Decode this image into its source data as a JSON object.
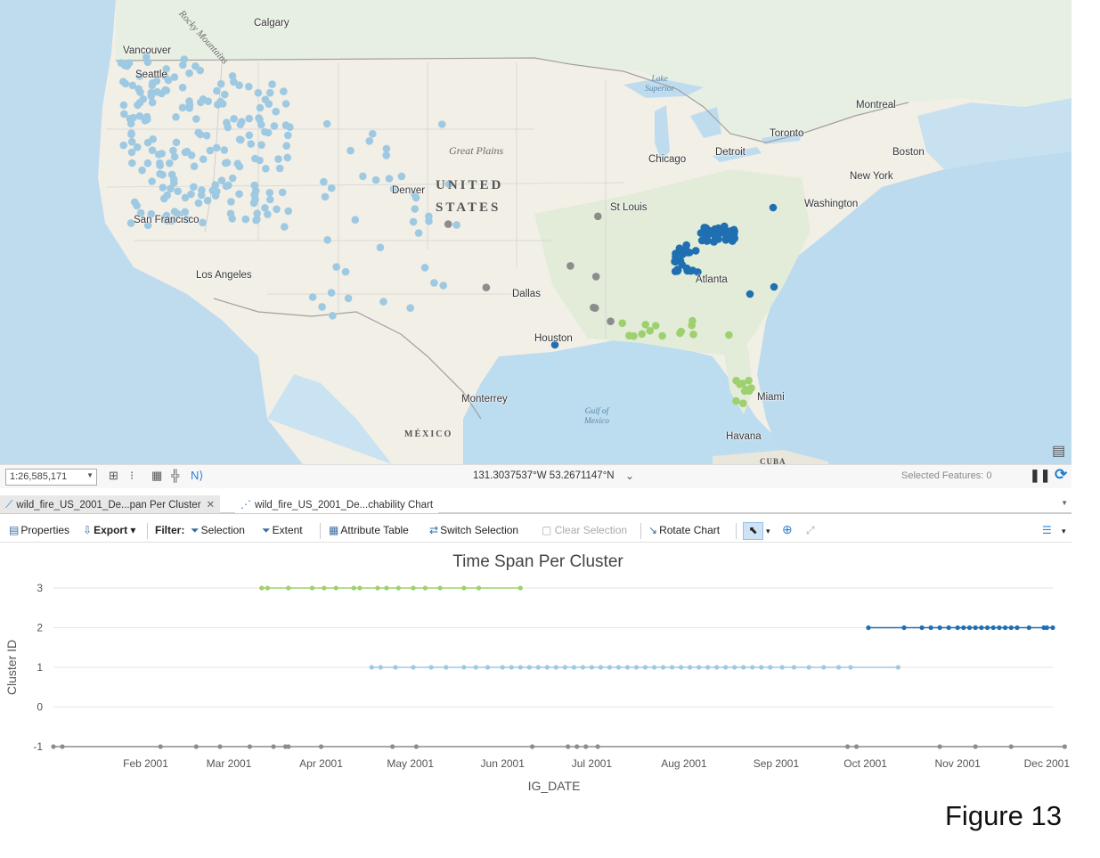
{
  "map": {
    "cities": [
      {
        "name": "Calgary"
      },
      {
        "name": "Vancouver"
      },
      {
        "name": "Seattle"
      },
      {
        "name": "San Francisco"
      },
      {
        "name": "Los Angeles"
      },
      {
        "name": "Denver"
      },
      {
        "name": "Dallas"
      },
      {
        "name": "Houston"
      },
      {
        "name": "Monterrey"
      },
      {
        "name": "St Louis"
      },
      {
        "name": "Chicago"
      },
      {
        "name": "Detroit"
      },
      {
        "name": "Toronto"
      },
      {
        "name": "Montreal"
      },
      {
        "name": "Boston"
      },
      {
        "name": "New York"
      },
      {
        "name": "Washington"
      },
      {
        "name": "Atlanta"
      },
      {
        "name": "Miami"
      },
      {
        "name": "Havana"
      }
    ],
    "region_labels": {
      "rocky": "Rocky Mountains",
      "great_plains": "Great Plains",
      "country_line1": "UNITED",
      "country_line2": "STATES",
      "mexico": "MÉXICO",
      "cuba": "CUBA"
    },
    "water_labels": {
      "lake_superior_1": "Lake",
      "lake_superior_2": "Superior",
      "gulf_1": "Gulf of",
      "gulf_2": "Mexico"
    },
    "cluster_colors": {
      "cluster_neg1": "#8c8c8c",
      "cluster_1": "#9ec9e2",
      "cluster_2": "#1f6fb2",
      "cluster_3": "#9ed06e"
    }
  },
  "statusbar": {
    "scale": "1:26,585,171",
    "coordinates": "131.3037537°W 53.2671147°N",
    "selected_features": "Selected Features: 0"
  },
  "tabs": [
    {
      "label": "wild_fire_US_2001_De...pan Per Cluster"
    },
    {
      "label": "wild_fire_US_2001_De...chability Chart"
    }
  ],
  "toolbar": {
    "properties": "Properties",
    "export": "Export",
    "filter": "Filter:",
    "selection": "Selection",
    "extent": "Extent",
    "attribute_table": "Attribute Table",
    "switch_selection": "Switch Selection",
    "clear_selection": "Clear Selection",
    "rotate_chart": "Rotate Chart"
  },
  "chart_data": {
    "type": "line",
    "title": "Time Span Per Cluster",
    "xlabel": "IG_DATE",
    "ylabel": "Cluster ID",
    "ylim": [
      -1,
      3
    ],
    "xlim": [
      "2001-01-01",
      "2001-12-03"
    ],
    "y_ticks": [
      "-1",
      "0",
      "1",
      "2",
      "3"
    ],
    "x_ticks": [
      {
        "date": "2001-02-01",
        "label": "Feb 2001"
      },
      {
        "date": "2001-03-01",
        "label": "Mar 2001"
      },
      {
        "date": "2001-04-01",
        "label": "Apr 2001"
      },
      {
        "date": "2001-05-01",
        "label": "May 2001"
      },
      {
        "date": "2001-06-01",
        "label": "Jun 2001"
      },
      {
        "date": "2001-07-01",
        "label": "Jul 2001"
      },
      {
        "date": "2001-08-01",
        "label": "Aug 2001"
      },
      {
        "date": "2001-09-01",
        "label": "Sep 2001"
      },
      {
        "date": "2001-10-01",
        "label": "Oct 2001"
      },
      {
        "date": "2001-11-01",
        "label": "Nov 2001"
      },
      {
        "date": "2001-12-01",
        "label": "Dec 2001"
      }
    ],
    "series": [
      {
        "y": 3,
        "color": "#9ed06e",
        "dates": [
          "2001-03-12",
          "2001-03-14",
          "2001-03-21",
          "2001-03-29",
          "2001-04-02",
          "2001-04-06",
          "2001-04-12",
          "2001-04-14",
          "2001-04-20",
          "2001-04-23",
          "2001-04-27",
          "2001-05-02",
          "2001-05-06",
          "2001-05-11",
          "2001-05-19",
          "2001-05-24",
          "2001-06-07"
        ]
      },
      {
        "y": 2,
        "color": "#1f6fb2",
        "dates": [
          "2001-10-02",
          "2001-10-14",
          "2001-10-20",
          "2001-10-23",
          "2001-10-26",
          "2001-10-29",
          "2001-11-01",
          "2001-11-03",
          "2001-11-05",
          "2001-11-07",
          "2001-11-09",
          "2001-11-11",
          "2001-11-13",
          "2001-11-15",
          "2001-11-17",
          "2001-11-19",
          "2001-11-21",
          "2001-11-25",
          "2001-11-30",
          "2001-12-01",
          "2001-12-03"
        ]
      },
      {
        "y": 1,
        "color": "#9ec9e2",
        "dates": [
          "2001-04-18",
          "2001-04-21",
          "2001-04-26",
          "2001-05-02",
          "2001-05-08",
          "2001-05-13",
          "2001-05-19",
          "2001-05-23",
          "2001-05-27",
          "2001-06-01",
          "2001-06-04",
          "2001-06-07",
          "2001-06-10",
          "2001-06-13",
          "2001-06-16",
          "2001-06-19",
          "2001-06-22",
          "2001-06-25",
          "2001-06-28",
          "2001-07-01",
          "2001-07-04",
          "2001-07-07",
          "2001-07-10",
          "2001-07-13",
          "2001-07-16",
          "2001-07-19",
          "2001-07-22",
          "2001-07-25",
          "2001-07-28",
          "2001-07-31",
          "2001-08-03",
          "2001-08-06",
          "2001-08-09",
          "2001-08-12",
          "2001-08-15",
          "2001-08-18",
          "2001-08-21",
          "2001-08-24",
          "2001-08-27",
          "2001-08-30",
          "2001-09-03",
          "2001-09-07",
          "2001-09-12",
          "2001-09-17",
          "2001-09-22",
          "2001-09-26",
          "2001-10-12"
        ]
      },
      {
        "y": -1,
        "color": "#8c8c8c",
        "dates": [
          "2001-01-01",
          "2001-01-04",
          "2001-02-06",
          "2001-02-18",
          "2001-02-26",
          "2001-03-08",
          "2001-03-16",
          "2001-03-20",
          "2001-03-21",
          "2001-04-01",
          "2001-04-25",
          "2001-05-03",
          "2001-06-11",
          "2001-06-23",
          "2001-06-26",
          "2001-06-29",
          "2001-07-03",
          "2001-09-25",
          "2001-09-28",
          "2001-10-26",
          "2001-11-07",
          "2001-11-19",
          "2001-12-07"
        ]
      }
    ]
  },
  "figure_label": "Figure 13"
}
